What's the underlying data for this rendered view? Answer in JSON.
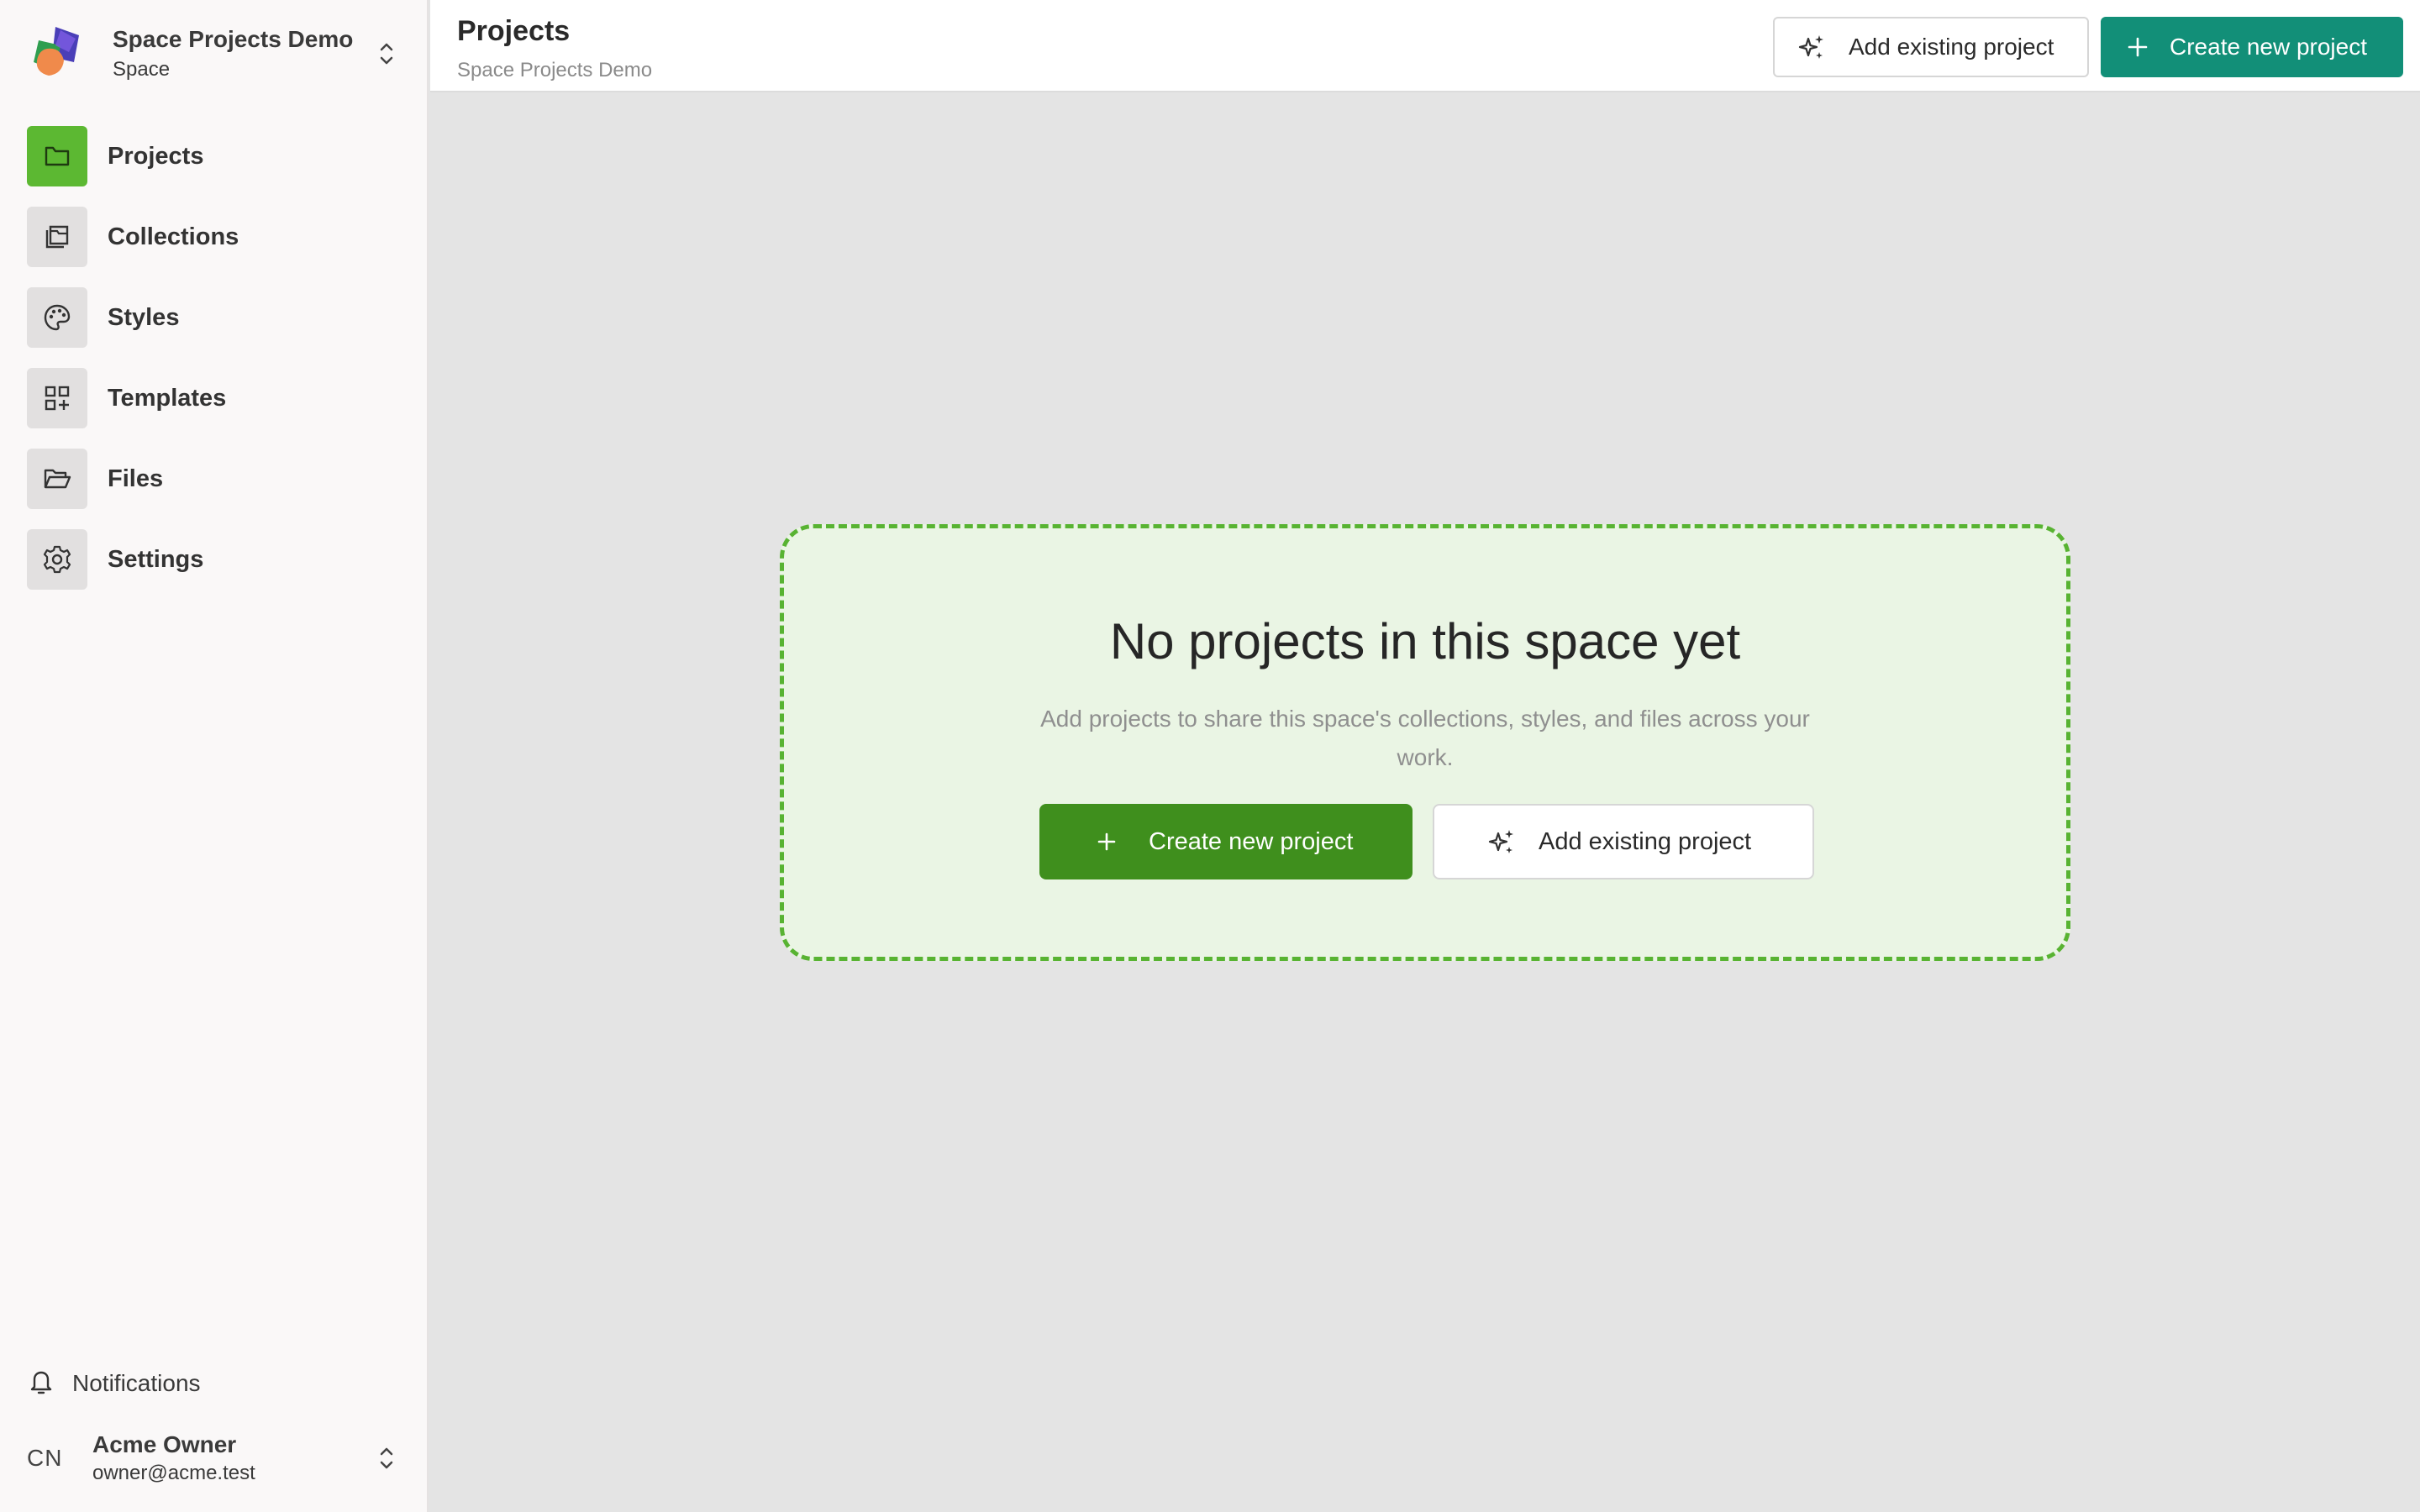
{
  "sidebar": {
    "space": {
      "name": "Space Projects Demo",
      "kind": "Space",
      "logo_icon": "space-logo"
    },
    "nav": [
      {
        "label": "Projects",
        "icon": "folder-icon",
        "active": true
      },
      {
        "label": "Collections",
        "icon": "collections-icon",
        "active": false
      },
      {
        "label": "Styles",
        "icon": "palette-icon",
        "active": false
      },
      {
        "label": "Templates",
        "icon": "grid-plus-icon",
        "active": false
      },
      {
        "label": "Files",
        "icon": "folder-open-icon",
        "active": false
      },
      {
        "label": "Settings",
        "icon": "gear-icon",
        "active": false
      }
    ],
    "notifications_label": "Notifications",
    "account": {
      "initials": "CN",
      "name": "Acme Owner",
      "email": "owner@acme.test"
    }
  },
  "header": {
    "title": "Projects",
    "breadcrumb": "Space Projects Demo",
    "add_existing_label": "Add existing project",
    "create_new_label": "Create new project"
  },
  "empty_state": {
    "title": "No projects in this space yet",
    "description": "Add projects to share this space's collections, styles, and files across your work.",
    "create_label": "Create new project",
    "add_existing_label": "Add existing project"
  },
  "colors": {
    "active_nav": "#5cb832",
    "header_primary": "#128f78",
    "empty_primary": "#3f8f1d",
    "empty_border": "#58b332",
    "empty_bg": "#eaf5e4"
  }
}
